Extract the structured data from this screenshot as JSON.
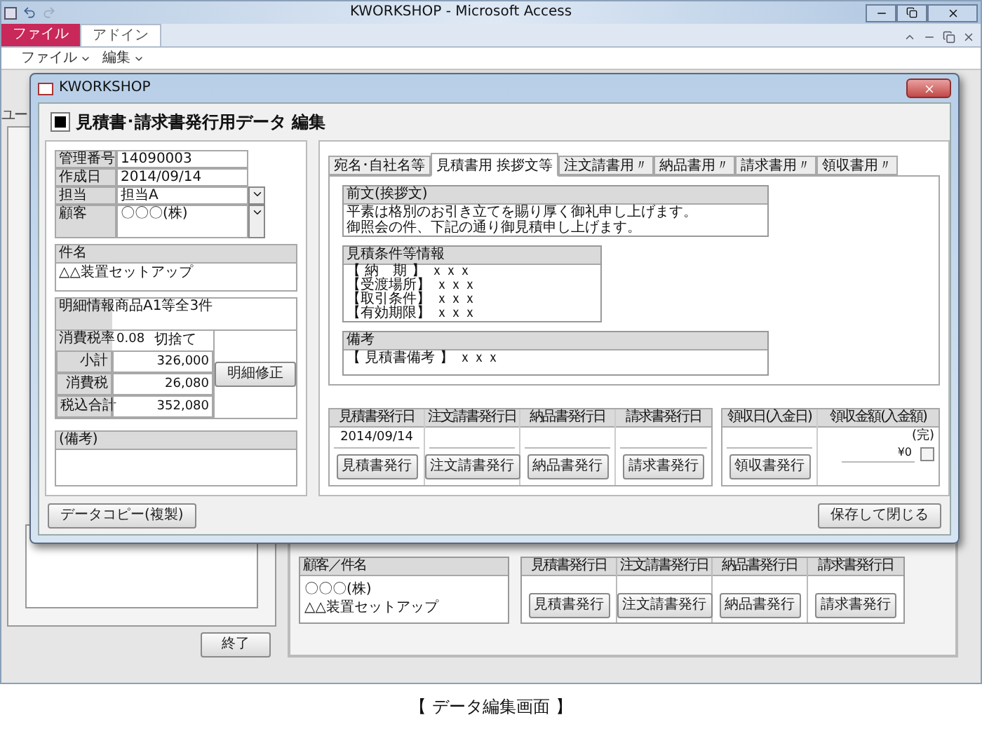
{
  "app": {
    "title": "KWORKSHOP - Microsoft Access",
    "ribbon_tabs": [
      {
        "label": "ファイル",
        "kind": "file",
        "selected": false
      },
      {
        "label": "アドイン",
        "kind": "tab",
        "selected": true
      }
    ],
    "ribbon_menus": [
      "ファイル",
      "編集"
    ]
  },
  "background": {
    "cut_label": "ユー",
    "exit_button": "終了",
    "list": {
      "columns": [
        "顧客／件名",
        "見積書発行日",
        "注文請書発行日",
        "納品書発行日",
        "請求書発行日"
      ],
      "customer": "〇〇〇(株)",
      "subject": "△△装置セットアップ",
      "buttons": [
        "見積書発行",
        "注文請書発行",
        "納品書発行",
        "請求書発行"
      ]
    }
  },
  "dialog": {
    "title": "KWORKSHOP",
    "heading": "見積書･請求書発行用データ 編集",
    "fields": [
      {
        "label": "管理番号",
        "value": "14090003",
        "kind": "text"
      },
      {
        "label": "作成日",
        "value": "2014/09/14",
        "kind": "text"
      },
      {
        "label": "担当",
        "value": "担当A",
        "kind": "combo"
      },
      {
        "label": "顧客",
        "value": "〇〇〇(株)",
        "kind": "combo"
      }
    ],
    "subject": {
      "label": "件名",
      "value": "△△装置セットアップ"
    },
    "details": {
      "label": "明細情報",
      "value": "商品A1等全3件",
      "tax_rate_label": "消費税率",
      "tax_rate": "0.08",
      "rounding": "切捨て",
      "totals": [
        {
          "label": "小計",
          "value": "326,000"
        },
        {
          "label": "消費税",
          "value": "26,080"
        },
        {
          "label": "税込合計",
          "value": "352,080"
        }
      ],
      "edit_button": "明細修正"
    },
    "remarks": {
      "label": "(備考)"
    },
    "tabs": [
      {
        "label": "宛名･自社名等",
        "selected": false
      },
      {
        "label": "見積書用 挨拶文等",
        "selected": true
      },
      {
        "label": "注文請書用〃",
        "selected": false
      },
      {
        "label": "納品書用〃",
        "selected": false
      },
      {
        "label": "請求書用〃",
        "selected": false
      },
      {
        "label": "領収書用〃",
        "selected": false
      }
    ],
    "preface": {
      "label": "前文(挨拶文)",
      "lines": [
        "平素は格別のお引き立てを賜り厚く御礼申し上げます。",
        "御照会の件、下記の通り御見積申し上げます。"
      ]
    },
    "conditions": {
      "label": "見積条件等情報",
      "lines": [
        "【 納　期 】 ｘｘｘ",
        "【受渡場所】 ｘｘｘ",
        "【取引条件】 ｘｘｘ",
        "【有効期限】 ｘｘｘ"
      ]
    },
    "note": {
      "label": "備考",
      "text": "【 見積書備考 】 ｘｘｘ"
    },
    "issue": [
      {
        "label": "見積書発行日",
        "date": "2014/09/14",
        "button": "見積書発行"
      },
      {
        "label": "注文請書発行日",
        "button": "注文請書発行"
      },
      {
        "label": "納品書発行日",
        "button": "納品書発行"
      },
      {
        "label": "請求書発行日",
        "button": "請求書発行"
      }
    ],
    "receipt": {
      "date_label": "領収日(入金日)",
      "button": "領収書発行",
      "amount_label": "領収金額(入金額)",
      "done_label": "(完)",
      "amount": "¥0",
      "paid": false
    },
    "copy_button": "データコピー(複製)",
    "save_button": "保存して閉じる"
  },
  "caption": "【 データ編集画面 】"
}
